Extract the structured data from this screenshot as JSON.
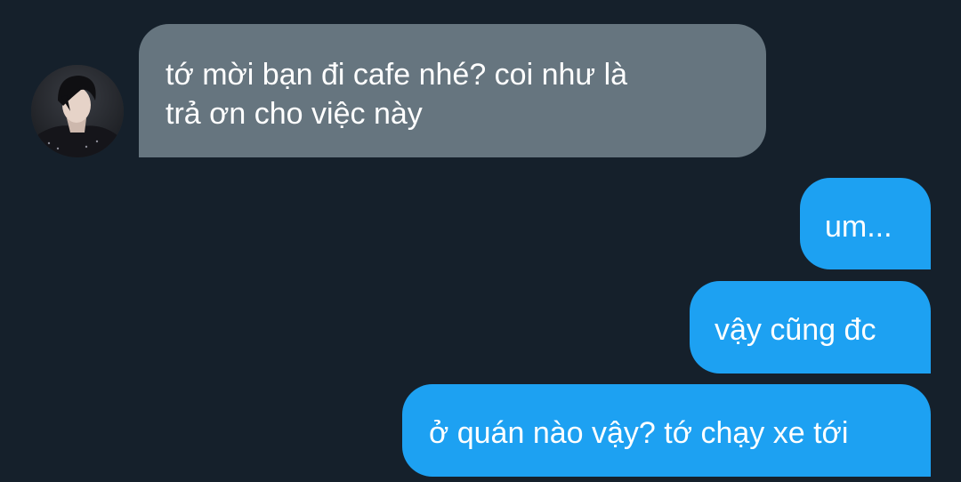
{
  "conversation": {
    "received": [
      {
        "line1": "tớ mời bạn đi cafe nhé? coi như là",
        "line2": "trả ơn cho việc này"
      }
    ],
    "sent": [
      {
        "text": "um..."
      },
      {
        "text": "vậy cũng đc"
      },
      {
        "text": "ở quán nào vậy? tớ chạy xe tới"
      }
    ]
  },
  "colors": {
    "background": "#15202b",
    "received_bubble": "#66757f",
    "sent_bubble": "#1da1f2",
    "text": "#ffffff"
  },
  "icons": {
    "avatar": "user-avatar"
  }
}
